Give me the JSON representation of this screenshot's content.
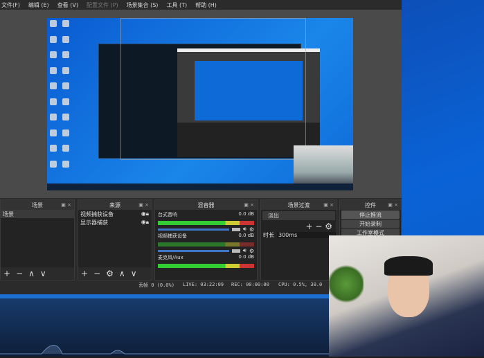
{
  "menu": [
    {
      "label": "文件(F)"
    },
    {
      "label": "编辑 (E)"
    },
    {
      "label": "查看 (V)"
    },
    {
      "label": "配置文件 (P)",
      "disabled": true
    },
    {
      "label": "场景集合 (S)"
    },
    {
      "label": "工具 (T)"
    },
    {
      "label": "帮助 (H)"
    }
  ],
  "scenes": {
    "title": "场景",
    "items": [
      "场景"
    ]
  },
  "sources": {
    "title": "来源",
    "items": [
      "视频捕获设备",
      "显示器捕获"
    ]
  },
  "mixer": {
    "title": "混音器",
    "channels": [
      {
        "name": "台式音响",
        "level": "0.0 dB"
      },
      {
        "name": "视频捕获设备",
        "level": "0.0 dB"
      },
      {
        "name": "麦克风/Aux",
        "level": "0.0 dB"
      }
    ]
  },
  "transitions": {
    "title": "场景过渡",
    "selected": "淡出",
    "duration_label": "时长",
    "duration": "300ms"
  },
  "controls": {
    "title": "控件",
    "buttons": [
      "停止推流",
      "开始录制",
      "工作室模式"
    ]
  },
  "status": {
    "dropped": "丢帧 0 (0.0%)",
    "live": "LIVE: 03:22:09",
    "rec": "REC: 00:00:00",
    "cpu": "CPU: 0.5%, 30.0"
  },
  "colors": {
    "accent": "#3f78c8",
    "desktop": "#0a63d6"
  }
}
